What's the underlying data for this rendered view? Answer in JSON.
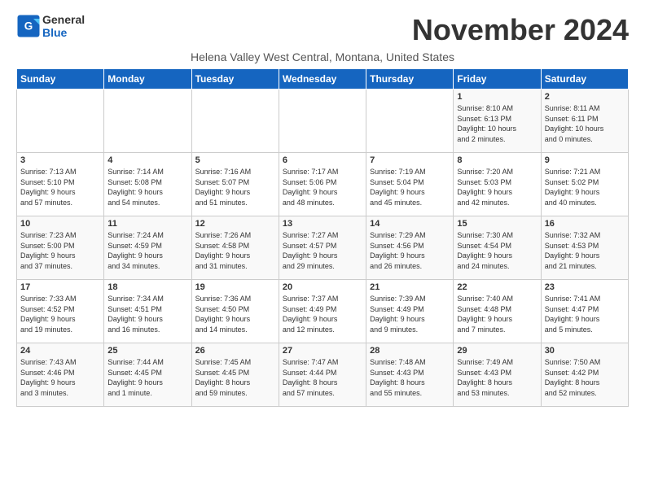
{
  "logo": {
    "line1": "General",
    "line2": "Blue"
  },
  "title": "November 2024",
  "subtitle": "Helena Valley West Central, Montana, United States",
  "days_header": [
    "Sunday",
    "Monday",
    "Tuesday",
    "Wednesday",
    "Thursday",
    "Friday",
    "Saturday"
  ],
  "weeks": [
    [
      {
        "num": "",
        "info": ""
      },
      {
        "num": "",
        "info": ""
      },
      {
        "num": "",
        "info": ""
      },
      {
        "num": "",
        "info": ""
      },
      {
        "num": "",
        "info": ""
      },
      {
        "num": "1",
        "info": "Sunrise: 8:10 AM\nSunset: 6:13 PM\nDaylight: 10 hours\nand 2 minutes."
      },
      {
        "num": "2",
        "info": "Sunrise: 8:11 AM\nSunset: 6:11 PM\nDaylight: 10 hours\nand 0 minutes."
      }
    ],
    [
      {
        "num": "3",
        "info": "Sunrise: 7:13 AM\nSunset: 5:10 PM\nDaylight: 9 hours\nand 57 minutes."
      },
      {
        "num": "4",
        "info": "Sunrise: 7:14 AM\nSunset: 5:08 PM\nDaylight: 9 hours\nand 54 minutes."
      },
      {
        "num": "5",
        "info": "Sunrise: 7:16 AM\nSunset: 5:07 PM\nDaylight: 9 hours\nand 51 minutes."
      },
      {
        "num": "6",
        "info": "Sunrise: 7:17 AM\nSunset: 5:06 PM\nDaylight: 9 hours\nand 48 minutes."
      },
      {
        "num": "7",
        "info": "Sunrise: 7:19 AM\nSunset: 5:04 PM\nDaylight: 9 hours\nand 45 minutes."
      },
      {
        "num": "8",
        "info": "Sunrise: 7:20 AM\nSunset: 5:03 PM\nDaylight: 9 hours\nand 42 minutes."
      },
      {
        "num": "9",
        "info": "Sunrise: 7:21 AM\nSunset: 5:02 PM\nDaylight: 9 hours\nand 40 minutes."
      }
    ],
    [
      {
        "num": "10",
        "info": "Sunrise: 7:23 AM\nSunset: 5:00 PM\nDaylight: 9 hours\nand 37 minutes."
      },
      {
        "num": "11",
        "info": "Sunrise: 7:24 AM\nSunset: 4:59 PM\nDaylight: 9 hours\nand 34 minutes."
      },
      {
        "num": "12",
        "info": "Sunrise: 7:26 AM\nSunset: 4:58 PM\nDaylight: 9 hours\nand 31 minutes."
      },
      {
        "num": "13",
        "info": "Sunrise: 7:27 AM\nSunset: 4:57 PM\nDaylight: 9 hours\nand 29 minutes."
      },
      {
        "num": "14",
        "info": "Sunrise: 7:29 AM\nSunset: 4:56 PM\nDaylight: 9 hours\nand 26 minutes."
      },
      {
        "num": "15",
        "info": "Sunrise: 7:30 AM\nSunset: 4:54 PM\nDaylight: 9 hours\nand 24 minutes."
      },
      {
        "num": "16",
        "info": "Sunrise: 7:32 AM\nSunset: 4:53 PM\nDaylight: 9 hours\nand 21 minutes."
      }
    ],
    [
      {
        "num": "17",
        "info": "Sunrise: 7:33 AM\nSunset: 4:52 PM\nDaylight: 9 hours\nand 19 minutes."
      },
      {
        "num": "18",
        "info": "Sunrise: 7:34 AM\nSunset: 4:51 PM\nDaylight: 9 hours\nand 16 minutes."
      },
      {
        "num": "19",
        "info": "Sunrise: 7:36 AM\nSunset: 4:50 PM\nDaylight: 9 hours\nand 14 minutes."
      },
      {
        "num": "20",
        "info": "Sunrise: 7:37 AM\nSunset: 4:49 PM\nDaylight: 9 hours\nand 12 minutes."
      },
      {
        "num": "21",
        "info": "Sunrise: 7:39 AM\nSunset: 4:49 PM\nDaylight: 9 hours\nand 9 minutes."
      },
      {
        "num": "22",
        "info": "Sunrise: 7:40 AM\nSunset: 4:48 PM\nDaylight: 9 hours\nand 7 minutes."
      },
      {
        "num": "23",
        "info": "Sunrise: 7:41 AM\nSunset: 4:47 PM\nDaylight: 9 hours\nand 5 minutes."
      }
    ],
    [
      {
        "num": "24",
        "info": "Sunrise: 7:43 AM\nSunset: 4:46 PM\nDaylight: 9 hours\nand 3 minutes."
      },
      {
        "num": "25",
        "info": "Sunrise: 7:44 AM\nSunset: 4:45 PM\nDaylight: 9 hours\nand 1 minute."
      },
      {
        "num": "26",
        "info": "Sunrise: 7:45 AM\nSunset: 4:45 PM\nDaylight: 8 hours\nand 59 minutes."
      },
      {
        "num": "27",
        "info": "Sunrise: 7:47 AM\nSunset: 4:44 PM\nDaylight: 8 hours\nand 57 minutes."
      },
      {
        "num": "28",
        "info": "Sunrise: 7:48 AM\nSunset: 4:43 PM\nDaylight: 8 hours\nand 55 minutes."
      },
      {
        "num": "29",
        "info": "Sunrise: 7:49 AM\nSunset: 4:43 PM\nDaylight: 8 hours\nand 53 minutes."
      },
      {
        "num": "30",
        "info": "Sunrise: 7:50 AM\nSunset: 4:42 PM\nDaylight: 8 hours\nand 52 minutes."
      }
    ]
  ]
}
